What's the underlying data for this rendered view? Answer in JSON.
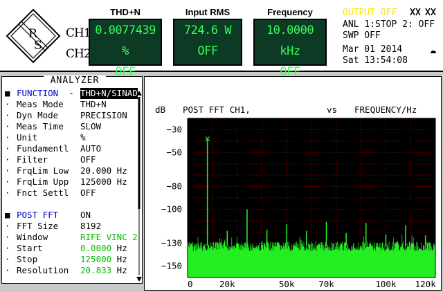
{
  "logo": {
    "letters": [
      "R",
      "S"
    ]
  },
  "channels": {
    "ch1": "CH1",
    "ch2": "CH2"
  },
  "measurements": [
    {
      "header": "THD+N",
      "ch1": "0.0077439 %",
      "ch2": "OFF"
    },
    {
      "header": "Input RMS",
      "ch1": "724.6  W",
      "ch2": "OFF"
    },
    {
      "header": "Frequency",
      "ch1": "10.0000 kHz",
      "ch2": "OFF"
    }
  ],
  "status": {
    "output": "OUTPUT OFF",
    "anl": "ANL 1:STOP 2: OFF",
    "swp": "SWP OFF",
    "date": "Mar 01 2014",
    "time": "Sat 13:54:08",
    "colors": {
      "output": "#ffe600"
    }
  },
  "analyzer": {
    "title": "ANALYZER",
    "rows": [
      {
        "label": "FUNCTION  -",
        "value": "THD+N/SINAD",
        "bullet": "■",
        "label_color": "#0000d0",
        "value_style": "selected"
      },
      {
        "label": "Meas Mode",
        "value": "THD+N",
        "bullet": "·"
      },
      {
        "label": "Dyn Mode",
        "value": "PRECISION",
        "bullet": "·"
      },
      {
        "label": "Meas Time",
        "value": "SLOW",
        "bullet": "·"
      },
      {
        "label": "Unit",
        "value": "%",
        "bullet": "·"
      },
      {
        "label": "Fundamentl",
        "value": "AUTO",
        "bullet": "·"
      },
      {
        "label": "Filter",
        "value": "OFF",
        "bullet": "·"
      },
      {
        "label": "FrqLim Low",
        "value": "20.000 Hz",
        "bullet": "·"
      },
      {
        "label": "FrqLim Upp",
        "value": "125000 Hz",
        "bullet": "·"
      },
      {
        "label": "Fnct Settl",
        "value": "OFF",
        "bullet": "·"
      },
      {
        "label": "",
        "value": "",
        "bullet": ""
      },
      {
        "label": "POST FFT",
        "value": "ON",
        "bullet": "■",
        "label_color": "#0000d0"
      },
      {
        "label": "FFT Size",
        "value": "8192",
        "bullet": "·"
      },
      {
        "label": "Window",
        "value": "RIFE VINC 2",
        "bullet": "·",
        "value_color": "#00c000"
      },
      {
        "label": "Start",
        "value": "0.0000 Hz",
        "bullet": "·",
        "value_color": "#00c000",
        "value_color_chars": 6
      },
      {
        "label": "Stop",
        "value": "125000 Hz",
        "bullet": "·",
        "value_color": "#00c000",
        "value_color_chars": 6
      },
      {
        "label": "Resolution",
        "value": "20.833 Hz",
        "bullet": "·",
        "value_color": "#00c000",
        "value_color_chars": 6
      }
    ]
  },
  "chart_data": {
    "type": "line",
    "title": "POST FFT CH1,",
    "ylabel": "dB",
    "xlabel": "FREQUENCY/Hz",
    "vs_label": "vs",
    "xlim": [
      0,
      125000
    ],
    "ylim": [
      -160,
      -20
    ],
    "grid": true,
    "x_ticks": [
      {
        "value": 0,
        "label": "0"
      },
      {
        "value": 20000,
        "label": "20k"
      },
      {
        "value": 50000,
        "label": "50k"
      },
      {
        "value": 70000,
        "label": "70k"
      },
      {
        "value": 100000,
        "label": "100k"
      },
      {
        "value": 120000,
        "label": "120k"
      }
    ],
    "y_ticks": [
      {
        "value": -30,
        "label": "−30"
      },
      {
        "value": -50,
        "label": "−50"
      },
      {
        "value": -80,
        "label": "−80"
      },
      {
        "value": -100,
        "label": "−100"
      },
      {
        "value": -130,
        "label": "−130"
      },
      {
        "value": -150,
        "label": "−150"
      }
    ],
    "marker": {
      "x": 10000,
      "y": -38
    },
    "peaks": [
      {
        "x": 10000,
        "y": -38
      },
      {
        "x": 20000,
        "y": -119
      },
      {
        "x": 30000,
        "y": -100
      },
      {
        "x": 40000,
        "y": -118
      },
      {
        "x": 50000,
        "y": -113
      },
      {
        "x": 60000,
        "y": -119
      },
      {
        "x": 70000,
        "y": -111
      },
      {
        "x": 80000,
        "y": -121
      },
      {
        "x": 90000,
        "y": -112
      },
      {
        "x": 100000,
        "y": -122
      },
      {
        "x": 110000,
        "y": -114
      },
      {
        "x": 120000,
        "y": -123
      }
    ],
    "noise_floor_db": -132,
    "colors": {
      "background": "#000000",
      "trace": "#22ee22",
      "grid": "#8a0000"
    }
  }
}
